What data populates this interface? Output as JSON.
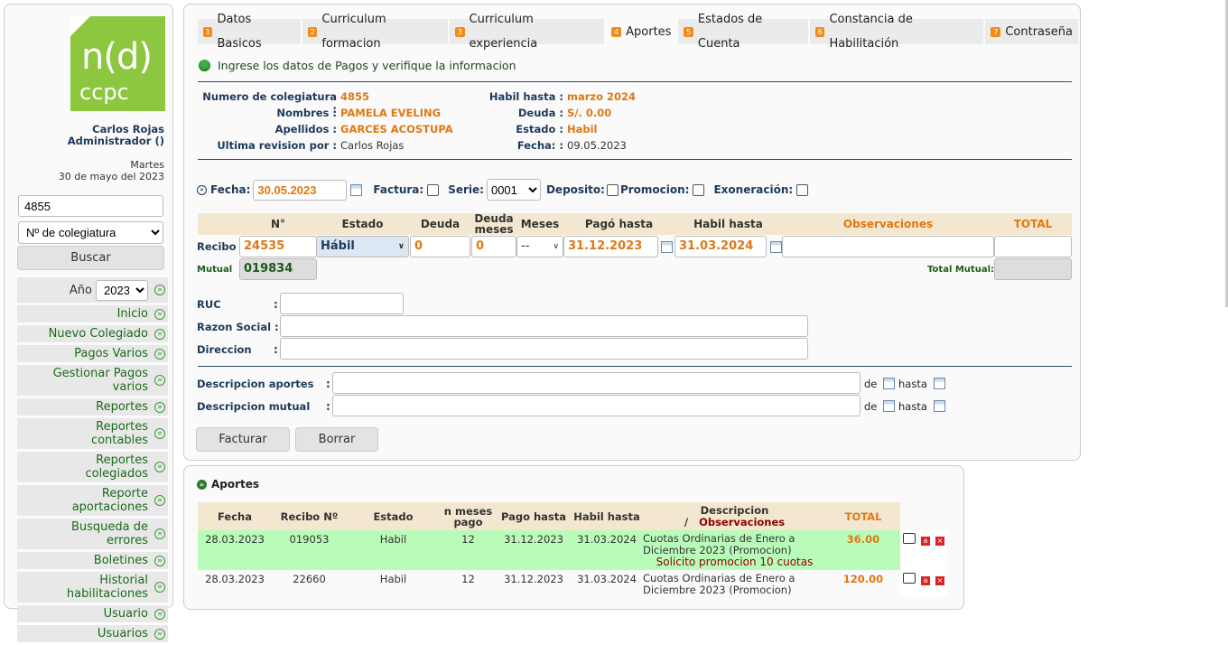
{
  "sidebar": {
    "logo_top": "n(d)",
    "logo_bottom": "ccpc",
    "user_name": "Carlos Rojas",
    "user_role": "Administrador ()",
    "weekday": "Martes",
    "date": "30 de mayo del 2023",
    "search_value": "4855",
    "search_type": "Nº de colegiatura",
    "search_button": "Buscar",
    "year_label": "Año",
    "year_value": "2023",
    "items": [
      "Inicio",
      "Nuevo Colegiado",
      "Pagos Varios",
      "Gestionar Pagos varios",
      "Reportes",
      "Reportes contables",
      "Reportes colegiados",
      "Reporte aportaciones",
      "Busqueda de errores",
      "Boletines",
      "Historial habilitaciones",
      "Usuario",
      "Usuarios"
    ]
  },
  "tabs": [
    {
      "n": "1",
      "label": "Datos Basicos"
    },
    {
      "n": "2",
      "label": "Curriculum formacion"
    },
    {
      "n": "3",
      "label": "Curriculum experiencia"
    },
    {
      "n": "4",
      "label": "Aportes"
    },
    {
      "n": "5",
      "label": "Estados de Cuenta"
    },
    {
      "n": "6",
      "label": "Constancia de Habilitación"
    },
    {
      "n": "7",
      "label": "Contraseña"
    }
  ],
  "info": "Ingrese los datos de Pagos y verifique la informacion",
  "member": {
    "colegiatura_label": "Numero de colegiatura :",
    "colegiatura": "4855",
    "nombres_label": "Nombres :",
    "nombres": "PAMELA EVELING",
    "apellidos_label": "Apellidos :",
    "apellidos": "GARCES ACOSTUPA",
    "revision_label": "Ultima revision por :",
    "revision": "Carlos Rojas",
    "habil_label": "Habil hasta :",
    "habil": "marzo 2024",
    "deuda_label": "Deuda :",
    "deuda": "S/. 0.00",
    "estado_label": "Estado :",
    "estado": "Habil",
    "fecha_label": "Fecha: :",
    "fecha": "09.05.2023"
  },
  "form": {
    "fecha_label": "Fecha:",
    "fecha": "30.05.2023",
    "factura_label": "Factura:",
    "serie_label": "Serie:",
    "serie": "0001",
    "deposito_label": "Deposito:",
    "promocion_label": "Promocion:",
    "exoneracion_label": "Exoneración:",
    "headers": [
      "N°",
      "Estado",
      "Deuda",
      "Deuda meses",
      "Meses",
      "Pagó hasta",
      "Habil hasta",
      "Observaciones",
      "TOTAL"
    ],
    "recibo_label": "Recibo",
    "recibo": "24535",
    "estado": "Hábil",
    "deuda": "0",
    "deuda_meses": "0",
    "meses": "--",
    "pago_hasta": "31.12.2023",
    "habil_hasta": "31.03.2024",
    "mutual_label": "Mutual",
    "mutual": "019834",
    "total_mutual_label": "Total Mutual:",
    "ruc_label": "RUC",
    "razon_label": "Razon Social",
    "direccion_label": "Direccion",
    "desc_aportes_label": "Descripcion aportes",
    "desc_mutual_label": "Descripcion mutual",
    "de": "de",
    "hasta": "hasta",
    "facturar": "Facturar",
    "borrar": "Borrar"
  },
  "aportes": {
    "title": "Aportes",
    "headers": [
      "Fecha",
      "Recibo Nº",
      "Estado",
      "n meses pago",
      "Pago hasta",
      "Habil hasta",
      "Descripcion",
      "Observaciones",
      "TOTAL"
    ],
    "rows": [
      {
        "fecha": "28.03.2023",
        "recibo": "019053",
        "estado": "Habil",
        "meses": "12",
        "pago": "31.12.2023",
        "habil": "31.03.2024",
        "desc": "Cuotas Ordinarias de Enero a Diciembre 2023 (Promocion)",
        "obs": "Solicito promocion 10 cuotas",
        "total": "36.00"
      },
      {
        "fecha": "28.03.2023",
        "recibo": "22660",
        "estado": "Habil",
        "meses": "12",
        "pago": "31.12.2023",
        "habil": "31.03.2024",
        "desc": "Cuotas Ordinarias de Enero a Diciembre 2023 (Promocion)",
        "obs": "",
        "total": "120.00"
      }
    ]
  }
}
